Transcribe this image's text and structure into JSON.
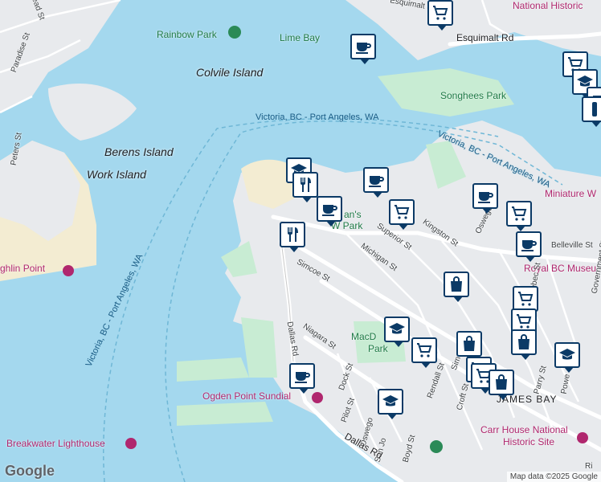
{
  "map": {
    "colors": {
      "water": "#a4d8ee",
      "land": "#e8eaed",
      "park": "#c8ecd3",
      "beach": "#f3ecd2",
      "road": "#ffffff",
      "pin_border": "#0b3a66"
    },
    "labels": {
      "esquimalt_st": "Esquimalt St",
      "esquimalt_rd": "Esquimalt Rd",
      "national_historic": "National Historic",
      "head_st": "Head St",
      "paradise_st": "Paradise St",
      "peters_st": "Peters St",
      "rainbow_park": "Rainbow Park",
      "lime_bay": "Lime Bay",
      "colvile_island": "Colvile Island",
      "songhees_park": "Songhees Park",
      "ferry_1": "Victoria, BC - Port Angeles, WA",
      "ferry_2": "Victoria, BC - Port Angeles, WA",
      "ferry_3": "Victoria, BC - Port Angeles, WA",
      "berens_island": "Berens Island",
      "work_island": "Work Island",
      "miniature_w": "Miniature W",
      "fishermans_wharf": "an's",
      "fishermans_wharf_park": "W   Park",
      "superior_st": "Superior St",
      "kingston_st": "Kingston St",
      "oswego_st": "Oswego St",
      "belleville_st": "Belleville St",
      "royal_bc_museum": "Royal BC Museu",
      "michigan_st": "Michigan St",
      "simcoe_st": "Simcoe St",
      "quebec_st": "ebec St",
      "niagara_st": "Niagara St",
      "dallas_rd": "Dallas Rd",
      "dallas_rd_2": "Dallas Rd",
      "macdonald_park": "MacD",
      "macdonald_park_2": "Park",
      "laughlin_point": "ghlin Point",
      "dock_st": "Dock St",
      "rendall_st": "Rendall St",
      "simcoe_st_2": "Simc",
      "croft_st": "Croft St",
      "parry_st": "Parry St",
      "government_st": "Government St",
      "power": "Powe",
      "james_bay": "JAMES BAY",
      "ogden_point": "Ogden Point Sundial",
      "pilot_st": "Pilot St",
      "oswego_st_2": "Oswego",
      "san_jose": "San Jo",
      "boyd_st": "Boyd St",
      "breakwater": "Breakwater Lighthouse",
      "carr_house_1": "Carr House National",
      "carr_house_2": "Historic Site",
      "ri": "Ri"
    },
    "attribution": "Map data ©2025 Google",
    "logo": "Google"
  },
  "markers": [
    {
      "type": "grocery",
      "name": "grocery-marker"
    },
    {
      "type": "cafe",
      "name": "cafe-marker"
    },
    {
      "type": "grocery",
      "name": "grocery-marker"
    },
    {
      "type": "school",
      "name": "school-marker"
    },
    {
      "type": "cafe",
      "name": "cafe-marker"
    },
    {
      "type": "bar",
      "name": "bar-marker"
    },
    {
      "type": "school",
      "name": "school-marker"
    },
    {
      "type": "restaurant",
      "name": "restaurant-marker"
    },
    {
      "type": "cafe",
      "name": "cafe-marker"
    },
    {
      "type": "cafe",
      "name": "cafe-marker"
    },
    {
      "type": "grocery",
      "name": "grocery-marker"
    },
    {
      "type": "restaurant",
      "name": "restaurant-marker"
    },
    {
      "type": "cafe",
      "name": "cafe-marker"
    },
    {
      "type": "grocery",
      "name": "grocery-marker"
    },
    {
      "type": "cafe",
      "name": "cafe-marker"
    },
    {
      "type": "shopping",
      "name": "shopping-marker"
    },
    {
      "type": "grocery",
      "name": "grocery-marker"
    },
    {
      "type": "grocery",
      "name": "grocery-marker"
    },
    {
      "type": "school",
      "name": "school-marker"
    },
    {
      "type": "grocery",
      "name": "grocery-marker"
    },
    {
      "type": "shopping",
      "name": "shopping-marker"
    },
    {
      "type": "shopping",
      "name": "shopping-marker"
    },
    {
      "type": "school",
      "name": "school-marker"
    },
    {
      "type": "grocery",
      "name": "grocery-marker"
    },
    {
      "type": "grocery",
      "name": "grocery-marker"
    },
    {
      "type": "shopping",
      "name": "shopping-marker"
    },
    {
      "type": "cafe",
      "name": "cafe-marker"
    },
    {
      "type": "school",
      "name": "school-marker"
    }
  ]
}
